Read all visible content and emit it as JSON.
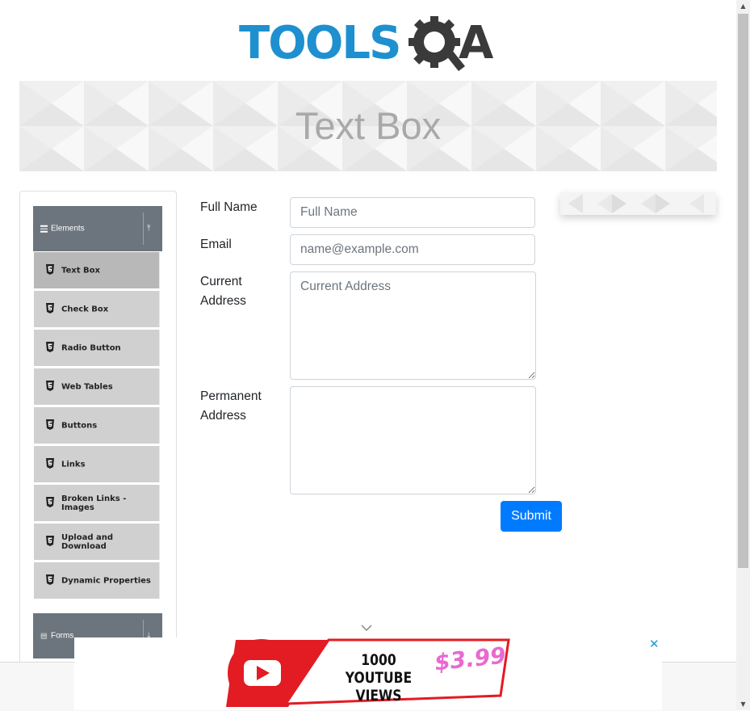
{
  "logo": {
    "text_tools": "TOOLS",
    "text_qa": "A"
  },
  "page": {
    "title": "Text Box"
  },
  "sidebar": {
    "groups": [
      {
        "label": "Elements",
        "icon": "menu-icon",
        "state_icon": "collapse-up-icon"
      },
      {
        "label": "Forms",
        "icon": "form-icon",
        "state_icon": "expand-down-icon"
      }
    ],
    "items": [
      {
        "label": "Text Box",
        "active": true
      },
      {
        "label": "Check Box"
      },
      {
        "label": "Radio Button"
      },
      {
        "label": "Web Tables"
      },
      {
        "label": "Buttons"
      },
      {
        "label": "Links"
      },
      {
        "label": "Broken Links - Images"
      },
      {
        "label": "Upload and Download"
      },
      {
        "label": "Dynamic Properties"
      }
    ]
  },
  "form": {
    "full_name": {
      "label": "Full Name",
      "placeholder": "Full Name",
      "value": ""
    },
    "email": {
      "label": "Email",
      "placeholder": "name@example.com",
      "value": ""
    },
    "current_address": {
      "label_line1": "Current",
      "label_line2": "Address",
      "placeholder": "Current Address",
      "value": ""
    },
    "permanent_address": {
      "label_line1": "Permanent",
      "label_line2": "Address",
      "placeholder": "",
      "value": ""
    },
    "submit_label": "Submit"
  },
  "ad": {
    "views_line1": "1000",
    "views_line2": "YOUTUBE VIEWS",
    "price": "$3.99",
    "close_label": "✕"
  },
  "colors": {
    "primary": "#007bff",
    "sidebar_header": "#6c757d",
    "logo_blue": "#1e90cf",
    "title_gray": "#a9a9a9"
  }
}
